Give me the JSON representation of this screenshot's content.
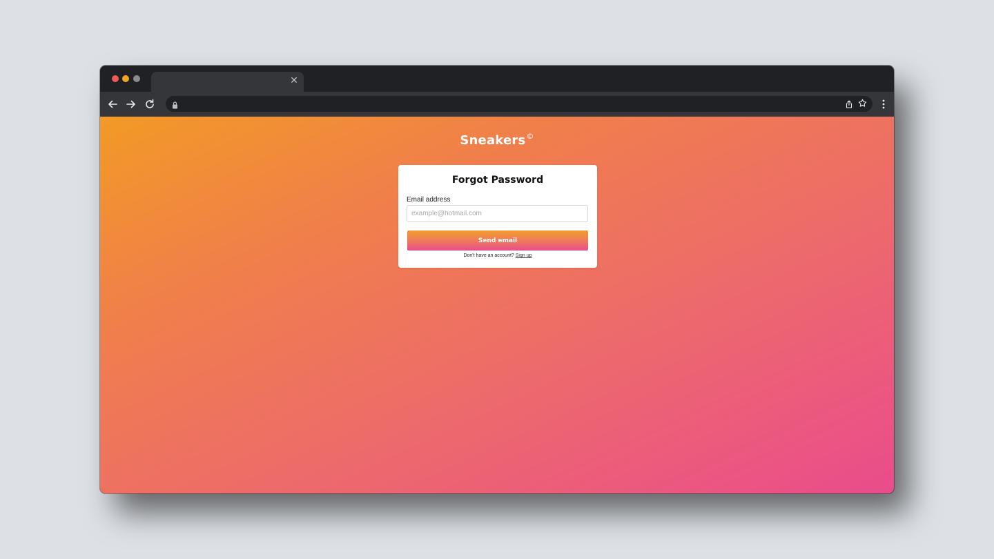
{
  "browser": {
    "tab": {
      "title": "",
      "close_label": "✕"
    },
    "address_bar": {
      "url": ""
    }
  },
  "page": {
    "brand": {
      "name": "Sneakers",
      "mark": "©"
    },
    "card": {
      "title": "Forgot Password",
      "email_label": "Email address",
      "email_value": "",
      "email_placeholder": "example@hotmail.com",
      "submit_label": "Send email",
      "signup_prompt": "Don't have an account?",
      "signup_link": "Sign up"
    }
  },
  "colors": {
    "gradient_start": "#f29a26",
    "gradient_end": "#ea4c8c",
    "card_background": "#ffffff",
    "chrome_dark": "#202124",
    "chrome_toolbar": "#35363a"
  }
}
